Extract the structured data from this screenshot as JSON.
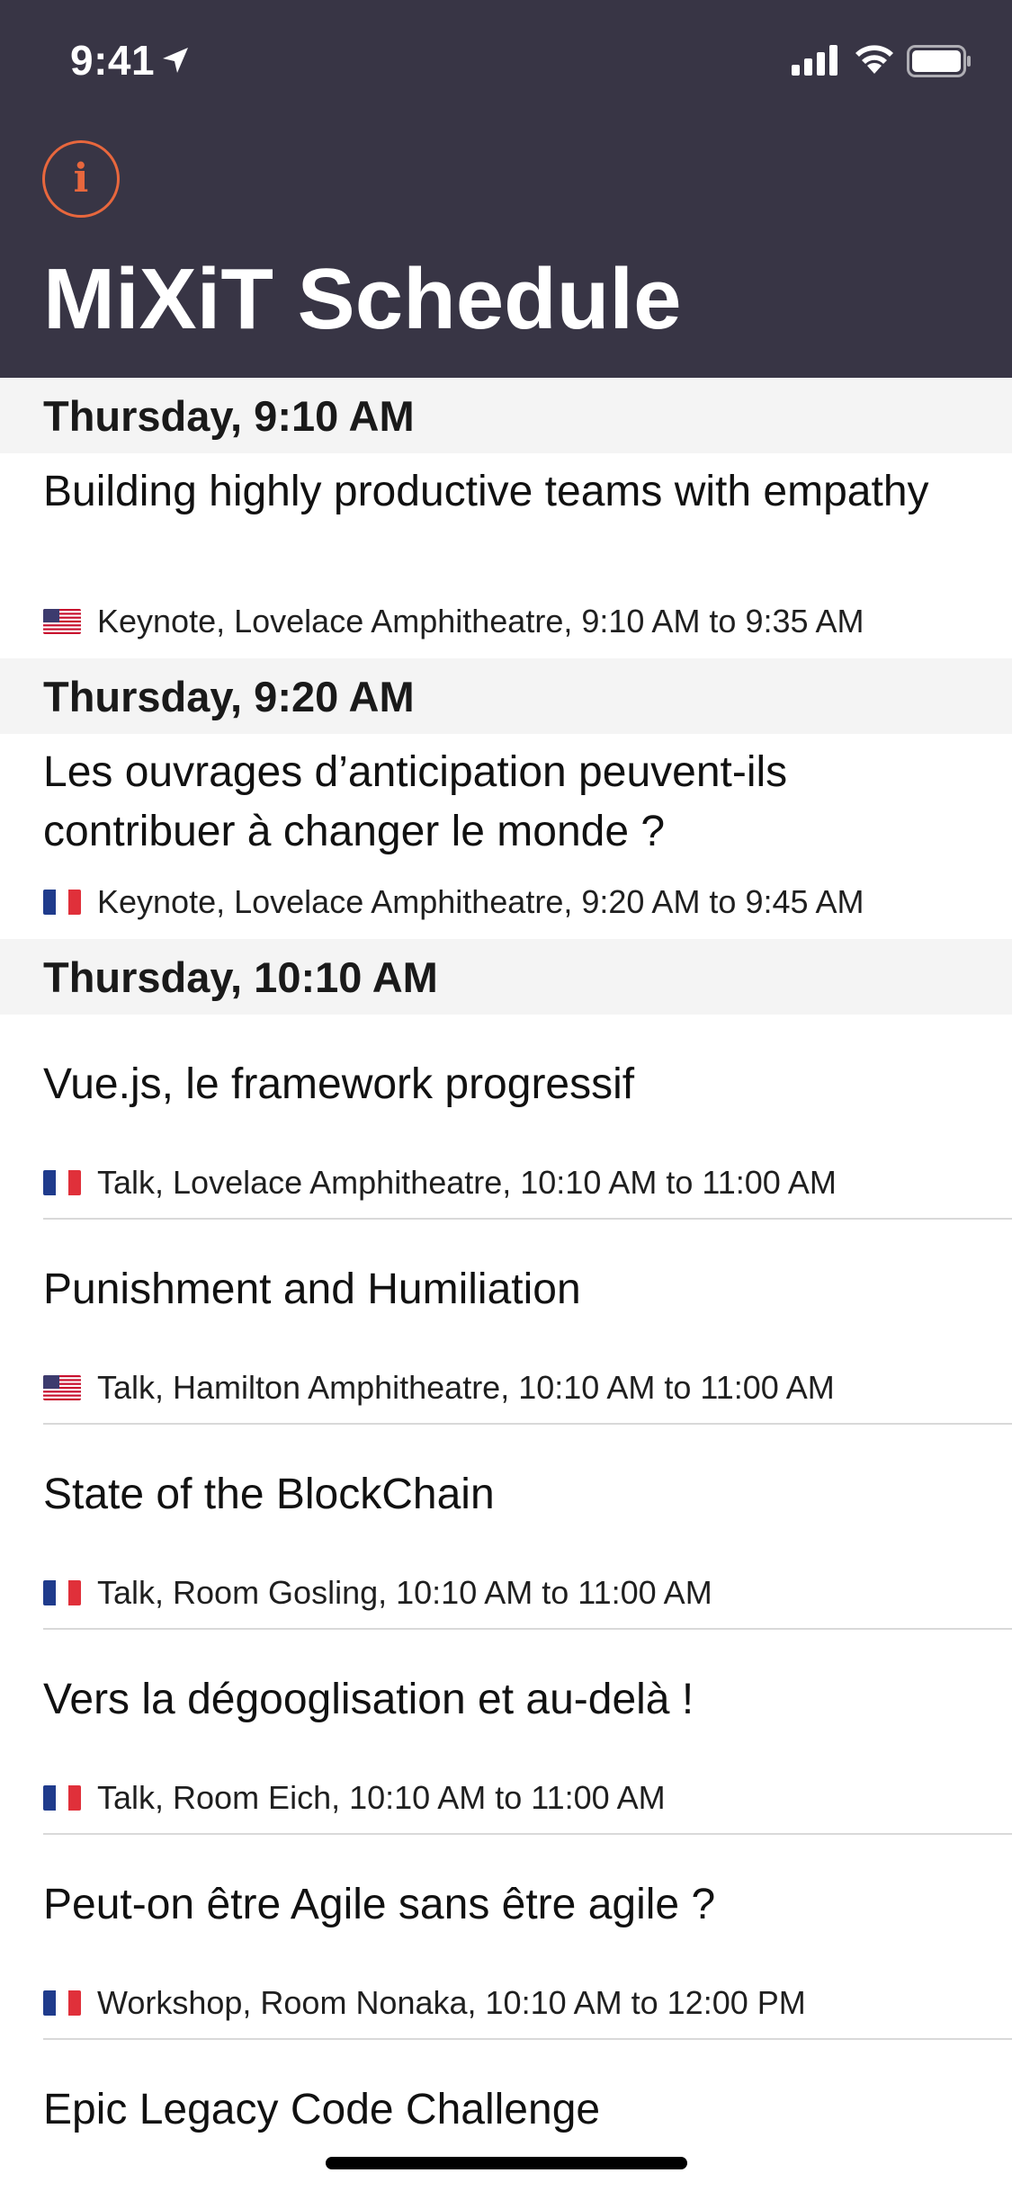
{
  "status_bar": {
    "time": "9:41"
  },
  "header": {
    "title": "MiXiT Schedule",
    "info_glyph": "i",
    "accent_color": "#e8673d",
    "background_color": "#383545"
  },
  "sections": [
    {
      "title": "Thursday, 9:10 AM",
      "sessions": [
        {
          "title": "Building highly productive teams with empathy",
          "language_flag": "us-flag-icon",
          "meta": "Keynote, Lovelace Amphitheatre, 9:10 AM to 9:35 AM"
        }
      ]
    },
    {
      "title": "Thursday, 9:20 AM",
      "sessions": [
        {
          "title": "Les ouvrages d’anticipation peuvent-ils contribuer à changer le monde ?",
          "language_flag": "fr-flag-icon",
          "meta": "Keynote, Lovelace Amphitheatre, 9:20 AM to 9:45 AM"
        }
      ]
    },
    {
      "title": "Thursday, 10:10 AM",
      "sessions": [
        {
          "title": "Vue.js, le framework progressif",
          "language_flag": "fr-flag-icon",
          "meta": "Talk, Lovelace Amphitheatre, 10:10 AM to 11:00 AM"
        },
        {
          "title": "Punishment and Humiliation",
          "language_flag": "us-flag-icon",
          "meta": "Talk, Hamilton Amphitheatre, 10:10 AM to 11:00 AM"
        },
        {
          "title": "State of the BlockChain",
          "language_flag": "fr-flag-icon",
          "meta": "Talk, Room Gosling, 10:10 AM to 11:00 AM"
        },
        {
          "title": "Vers la dégooglisation et au-delà !",
          "language_flag": "fr-flag-icon",
          "meta": "Talk, Room Eich, 10:10 AM to 11:00 AM"
        },
        {
          "title": "Peut-on être Agile sans être agile ?",
          "language_flag": "fr-flag-icon",
          "meta": "Workshop, Room Nonaka, 10:10 AM to 12:00 PM"
        },
        {
          "title": "Epic Legacy Code Challenge"
        }
      ]
    }
  ]
}
